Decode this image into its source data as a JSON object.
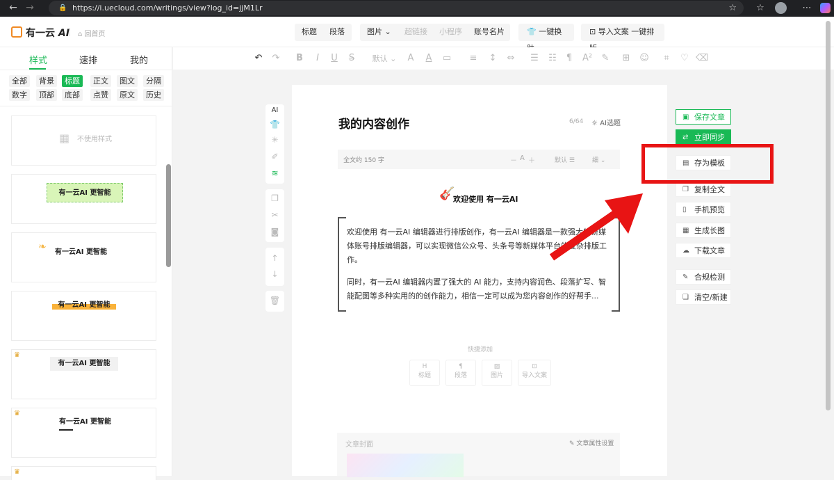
{
  "browser": {
    "url": "https://i.uecloud.com/writings/view?log_id=jjM1Lr",
    "icons": [
      "back-icon",
      "forward-icon",
      "reload-icon",
      "lock-icon",
      "star-icon",
      "favorites-icon",
      "profile-avatar",
      "copilot-icon"
    ]
  },
  "app": {
    "logo_text": "有一云",
    "logo_suffix": "AI",
    "home_link": "回首页",
    "header": {
      "group1": [
        "标题",
        "段落"
      ],
      "group2": [
        "图片",
        "超链接",
        "小程序",
        "账号名片"
      ],
      "skin": "一键换肤",
      "import": "导入文案 一键排版"
    }
  },
  "left": {
    "tabs": [
      "样式",
      "速排",
      "我的"
    ],
    "chips_row1": [
      "全部",
      "背景",
      "标题",
      "正文",
      "图文",
      "分隔"
    ],
    "chips_row2": [
      "数字",
      "顶部",
      "底部",
      "点赞",
      "原文",
      "历史"
    ],
    "no_style": "不使用样式",
    "sample_text": "有一云AI 更智能"
  },
  "toolbar": {
    "font_default": "默认"
  },
  "editor": {
    "title": "我的内容创作",
    "title_count": "6/64",
    "ai_title": "AI选题",
    "word_count": "全文约 150 字",
    "size_minus": "－",
    "size_a": "A",
    "size_plus": "＋",
    "spacing_default": "默认",
    "weight": "细",
    "welcome": "欢迎使用 有一云AI",
    "para1": "欢迎使用 有一云AI 编辑器进行排版创作，有一云AI 编辑器是一款强大的新媒体账号排版编辑器，可以实现微信公众号、头条号等新媒体平台的复杂排版工作。",
    "para2": "同时，有一云AI 编辑器内置了强大的 AI 能力，支持内容润色、段落扩写、智能配图等多种实用的的创作能力，相信一定可以成为您内容创作的好帮手...",
    "quick_add": "快捷添加",
    "quick_items": [
      "标题",
      "段落",
      "图片",
      "导入文案"
    ],
    "cover": "文章封面",
    "cover_settings": "文章属性设置"
  },
  "actions": {
    "save": "保存文章",
    "sync": "立即同步",
    "template": "存为模板",
    "copy": "复制全文",
    "preview": "手机预览",
    "long_image": "生成长图",
    "download": "下载文章",
    "compliance": "合规检测",
    "clear": "清空/新建"
  }
}
